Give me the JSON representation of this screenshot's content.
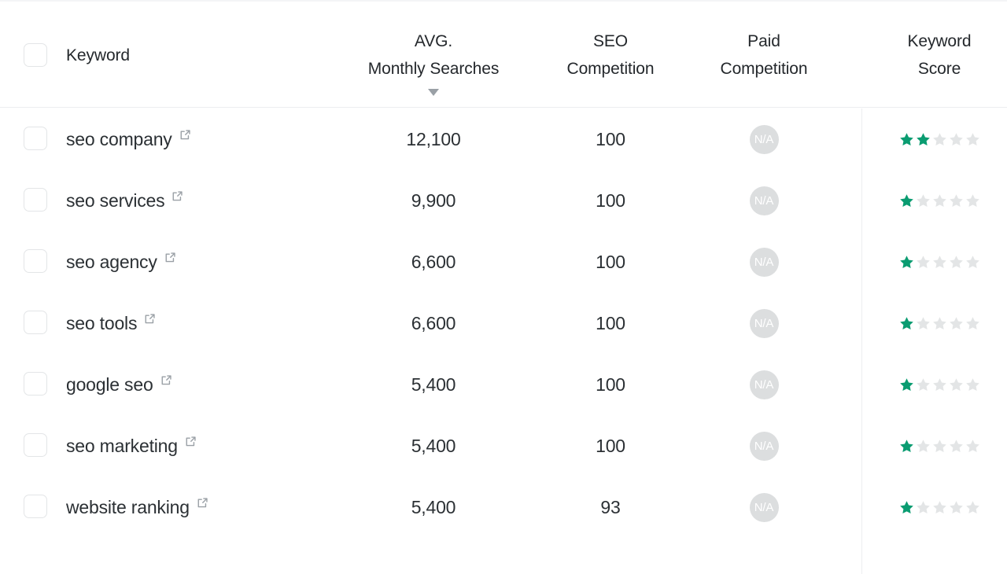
{
  "table": {
    "columns": [
      {
        "id": "select",
        "label": ""
      },
      {
        "id": "keyword",
        "label": "Keyword"
      },
      {
        "id": "avg_monthly_searches",
        "label_line1": "AVG.",
        "label_line2": "Monthly Searches",
        "sorted": "desc",
        "sort_icon": "chevron-down-icon"
      },
      {
        "id": "seo_competition",
        "label_line1": "SEO",
        "label_line2": "Competition"
      },
      {
        "id": "paid_competition",
        "label_line1": "Paid",
        "label_line2": "Competition"
      },
      {
        "id": "keyword_score",
        "label_line1": "Keyword",
        "label_line2": "Score"
      }
    ],
    "star_max": 5,
    "na_label": "N/A",
    "rows": [
      {
        "keyword": "seo company",
        "link_icon": "external-link-icon",
        "avg_monthly_searches": "12,100",
        "seo_competition": "100",
        "paid_competition": "N/A",
        "keyword_score": 2
      },
      {
        "keyword": "seo services",
        "link_icon": "external-link-icon",
        "avg_monthly_searches": "9,900",
        "seo_competition": "100",
        "paid_competition": "N/A",
        "keyword_score": 1
      },
      {
        "keyword": "seo agency",
        "link_icon": "external-link-icon",
        "avg_monthly_searches": "6,600",
        "seo_competition": "100",
        "paid_competition": "N/A",
        "keyword_score": 1
      },
      {
        "keyword": "seo tools",
        "link_icon": "external-link-icon",
        "avg_monthly_searches": "6,600",
        "seo_competition": "100",
        "paid_competition": "N/A",
        "keyword_score": 1
      },
      {
        "keyword": "google seo",
        "link_icon": "external-link-icon",
        "avg_monthly_searches": "5,400",
        "seo_competition": "100",
        "paid_competition": "N/A",
        "keyword_score": 1
      },
      {
        "keyword": "seo marketing",
        "link_icon": "external-link-icon",
        "avg_monthly_searches": "5,400",
        "seo_competition": "100",
        "paid_competition": "N/A",
        "keyword_score": 1
      },
      {
        "keyword": "website ranking",
        "link_icon": "external-link-icon",
        "avg_monthly_searches": "5,400",
        "seo_competition": "93",
        "paid_competition": "N/A",
        "keyword_score": 1
      }
    ]
  },
  "colors": {
    "star_active": "#0a9c71",
    "star_inactive": "#e3e5e6",
    "na_badge_bg": "#dcdedf",
    "text": "#2b3034",
    "border": "#eceef0",
    "checkbox_border": "#e3e5e7"
  }
}
